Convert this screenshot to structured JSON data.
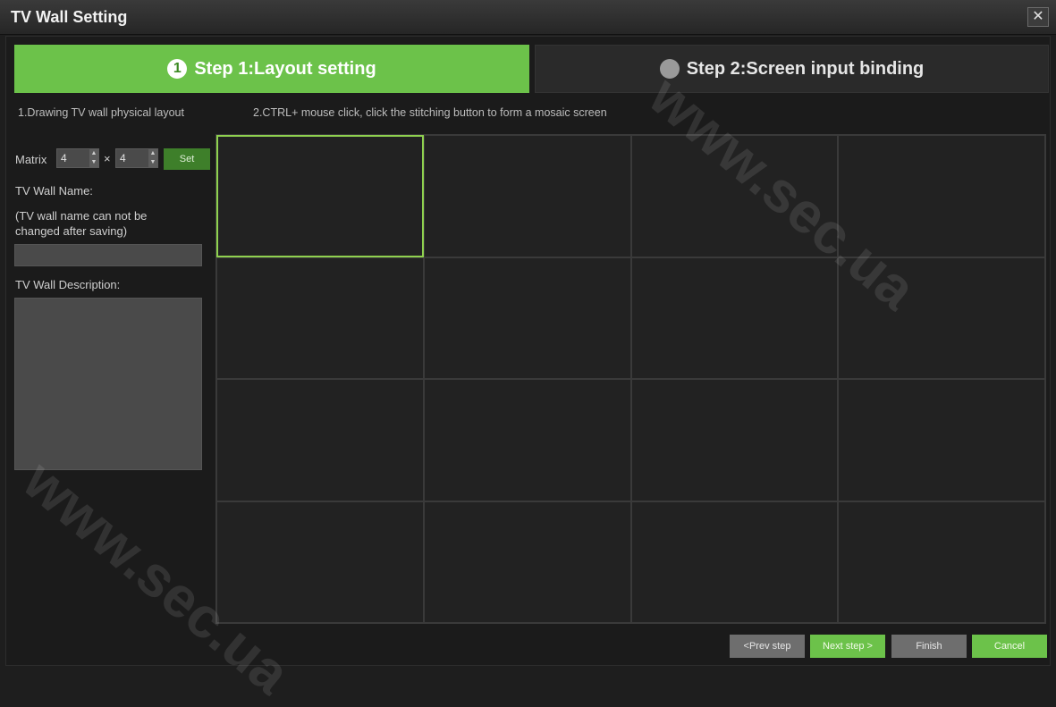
{
  "window": {
    "title": "TV Wall Setting",
    "close_label": "✕"
  },
  "steps": [
    {
      "number": "1",
      "label": "Step 1:Layout setting",
      "active": true
    },
    {
      "number": "",
      "label": "Step 2:Screen input binding",
      "active": false
    }
  ],
  "hints": {
    "hint1": "1.Drawing TV wall physical layout",
    "hint2": "2.CTRL+ mouse click, click the stitching button to form a mosaic screen"
  },
  "matrix": {
    "label": "Matrix",
    "rows": "4",
    "separator": "×",
    "cols": "4",
    "set_label": "Set"
  },
  "tv_wall_name": {
    "label": "TV Wall Name:",
    "note": "(TV wall name can not be changed after saving)",
    "value": ""
  },
  "tv_wall_description": {
    "label": "TV Wall Description:",
    "value": ""
  },
  "grid": {
    "rows": 4,
    "cols": 4,
    "selected_cell": 0
  },
  "buttons": {
    "prev": "<Prev step",
    "next": "Next step >",
    "finish": "Finish",
    "cancel": "Cancel"
  },
  "colors": {
    "accent": "#6cc24a",
    "selected_border": "#8fd14f",
    "background": "#1e1e1e"
  },
  "watermark": "www.sec.ua"
}
